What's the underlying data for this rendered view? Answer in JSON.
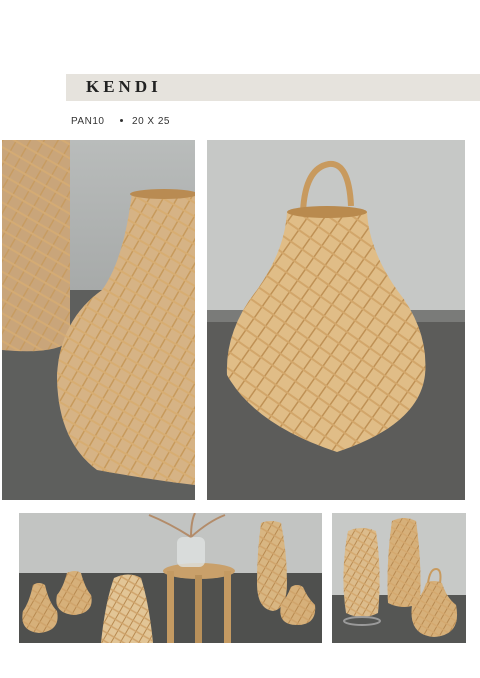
{
  "product": {
    "name": "KENDI",
    "code": "PAN10",
    "size": "20 X 25"
  },
  "photos": [
    {
      "id": "closeup"
    },
    {
      "id": "full-view"
    },
    {
      "id": "room-scene"
    },
    {
      "id": "lamp-group"
    }
  ]
}
